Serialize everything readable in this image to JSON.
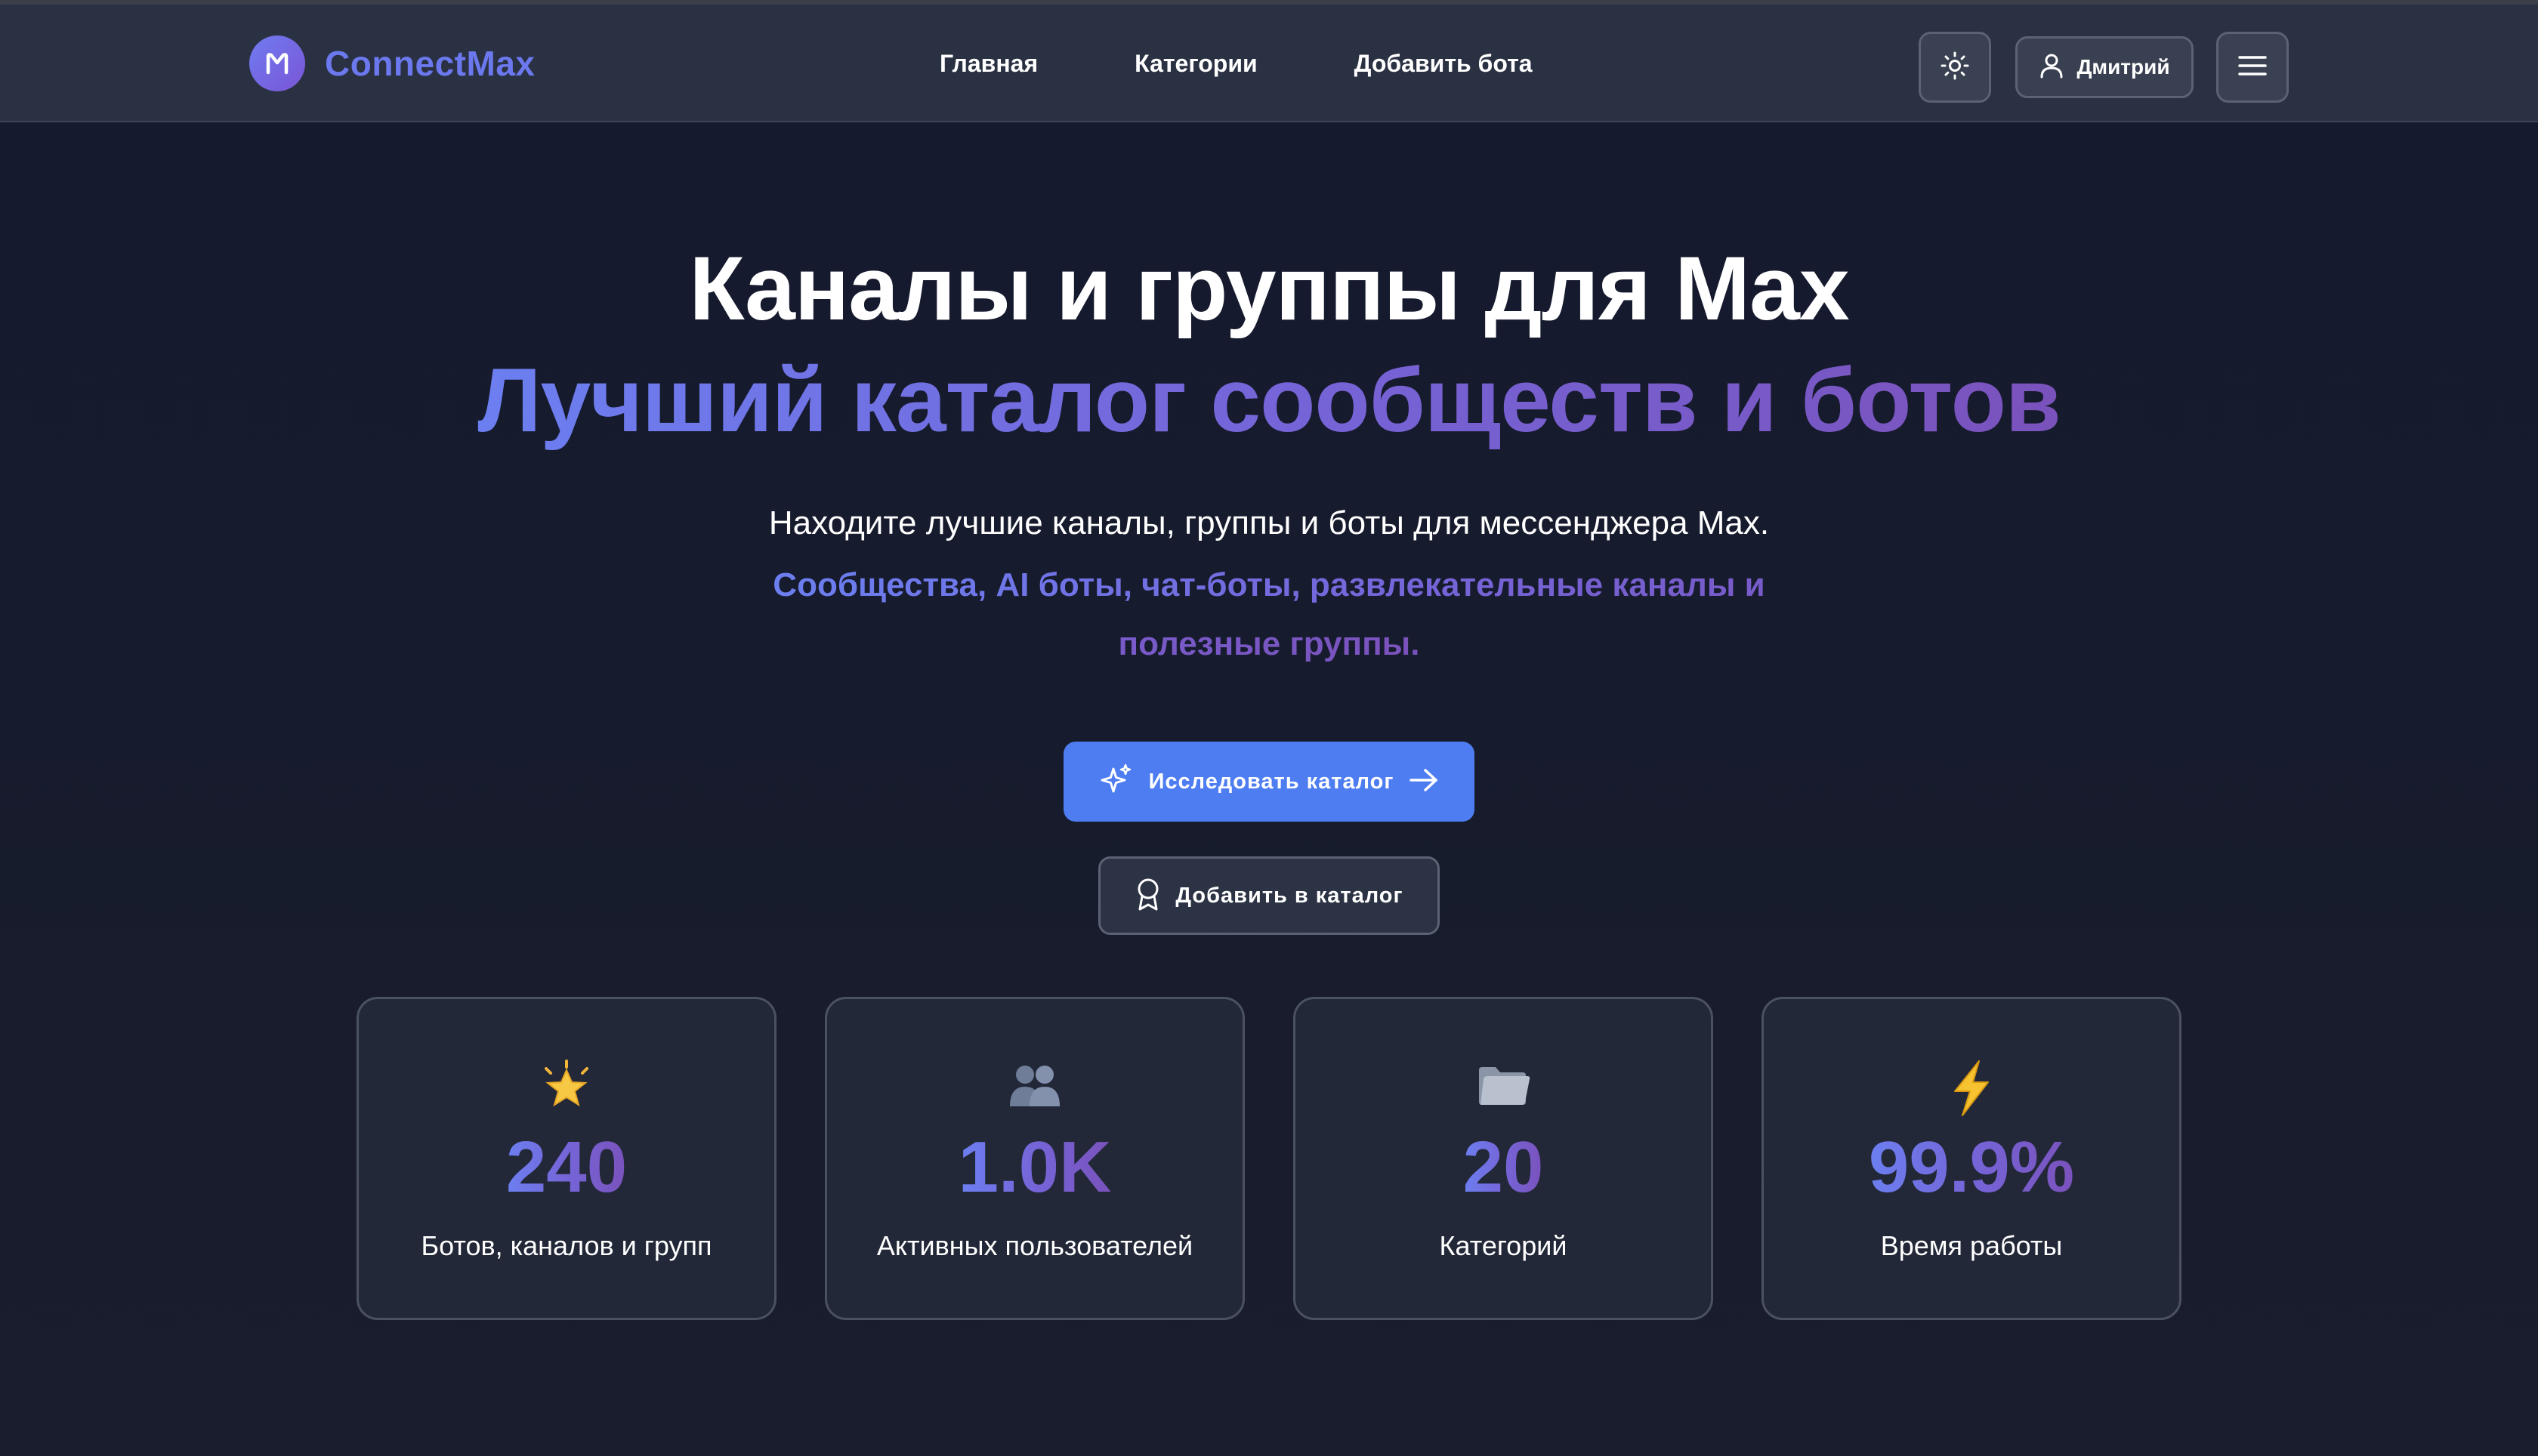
{
  "header": {
    "brand": "ConnectMax",
    "nav": [
      "Главная",
      "Категории",
      "Добавить бота"
    ],
    "user_name": "Дмитрий",
    "theme_icon": "sun-icon",
    "menu_icon": "hamburger-icon"
  },
  "hero": {
    "title": "Каналы и группы для Max",
    "accent": "Лучший каталог сообществ и ботов",
    "subtitle": "Находите лучшие каналы, группы и боты для мессенджера Max.",
    "subtitle_accent": "Сообщества, AI боты, чат-боты, развлекательные каналы и полезные группы."
  },
  "buttons": {
    "explore": "Исследовать каталог",
    "add": "Добавить в каталог"
  },
  "stats": [
    {
      "icon": "star-emoji",
      "value": "240",
      "label": "Ботов, каналов и групп"
    },
    {
      "icon": "people-emoji",
      "value": "1.0K",
      "label": "Активных пользователей"
    },
    {
      "icon": "folder-emoji",
      "value": "20",
      "label": "Категорий"
    },
    {
      "icon": "lightning-emoji",
      "value": "99.9%",
      "label": "Время работы"
    }
  ],
  "colors": {
    "background": "#161b2d",
    "header": "#2a3142",
    "accent_blue": "#4d7df1",
    "gradient_start": "#6c7ff0",
    "gradient_end": "#7a52bc"
  }
}
